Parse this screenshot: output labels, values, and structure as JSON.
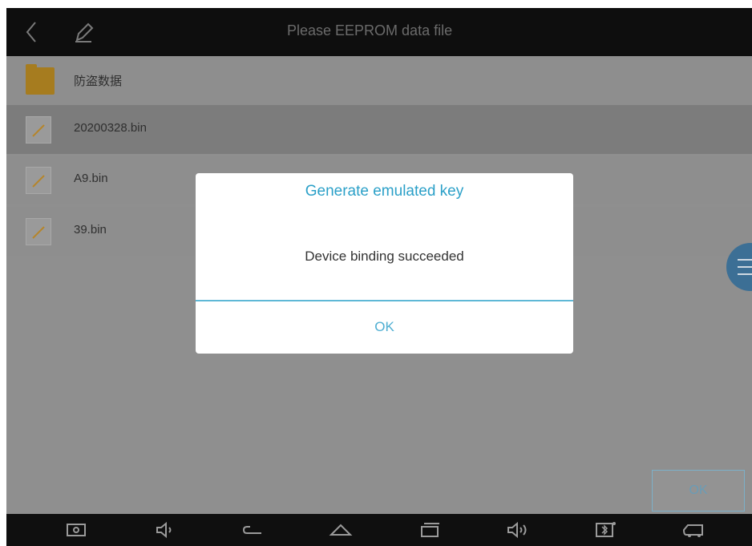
{
  "topbar": {
    "title": "Please EEPROM data file",
    "back_icon": "chevron-left-icon",
    "edit_icon": "pencil-icon"
  },
  "files": [
    {
      "label": "防盗数据",
      "type": "folder",
      "icon": "folder-icon"
    },
    {
      "label": "20200328.bin",
      "type": "file",
      "icon": "file-icon"
    },
    {
      "label": "A9.bin",
      "type": "file",
      "icon": "file-icon"
    },
    {
      "label": "39.bin",
      "type": "file",
      "icon": "file-icon"
    }
  ],
  "dialog": {
    "title": "Generate emulated key",
    "message": "Device binding succeeded",
    "ok_label": "OK"
  },
  "bottom": {
    "ok_label": "OK"
  },
  "navbar": {
    "icons": [
      "screenshot-icon",
      "volume-down-icon",
      "back-icon",
      "home-icon",
      "recent-apps-icon",
      "volume-up-icon",
      "bluetooth-icon",
      "vci-connector-icon"
    ]
  },
  "colors": {
    "accent": "#2ba0c8",
    "folder": "#a67c1f",
    "topbar": "#0e0e0e"
  }
}
